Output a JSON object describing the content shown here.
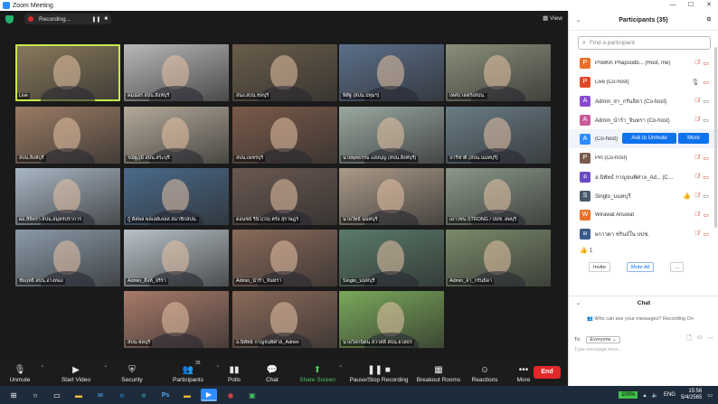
{
  "window": {
    "title": "Zoom Meeting",
    "controls": [
      "—",
      "☐",
      "✕"
    ]
  },
  "video": {
    "recording_label": "Recording...",
    "view_label": "View",
    "tiles": [
      {
        "name": "Live",
        "bg": "#8a7a5c",
        "active": true
      },
      {
        "name": "คมน์สร สปน.สิงห์บุรี",
        "bg": "#b8b8b8"
      },
      {
        "name": "สนง.สปน.ชลบุรี",
        "bg": "#6a5d4a"
      },
      {
        "name": "พิสิฐ (สปน.ปทุมฯ)",
        "bg": "#5b6f8a"
      },
      {
        "name": "เทศบาลตรังสปน.",
        "bg": "#8a8f7a"
      },
      {
        "name": "สปน.สิงห์บุรี",
        "bg": "#9a7b64"
      },
      {
        "name": "รณัฐภูมิ สปน.สระบุรี",
        "bg": "#b4aa9a"
      },
      {
        "name": "สปน.เพชรบุรี",
        "bg": "#7a5a4a"
      },
      {
        "name": "นายพุทธรรม แสงบุญ (สปน.สิงห์บุรี)",
        "bg": "#9aa8a0"
      },
      {
        "name": "ปาริชาติ (สปน.นนทบุรี)",
        "bg": "#6a7c86"
      },
      {
        "name": "ผอ.ลิจิตรา สปน.สมุทรปราการ",
        "bg": "#a8b6c4"
      },
      {
        "name": "กู้ ดิสพล พลเลย์เลลส สมาชิกสปน.",
        "bg": "#4a6a8a"
      },
      {
        "name": "ดอนชธ์ รินิว(ใจ) ตรัง สุราษฎร์",
        "bg": "#6a5850"
      },
      {
        "name": "นายวัทธ์ นนทบุรี",
        "bg": "#aa9a88"
      },
      {
        "name": "เยาวชน STRONG / ปปช. ลพบุรี",
        "bg": "#8a9888"
      },
      {
        "name": "ชัยฤทธิ์ สปน.อ่างทอง",
        "bg": "#8a9aa8"
      },
      {
        "name": "Admin_สิงห์_จรีรา",
        "bg": "#b8c2c8"
      },
      {
        "name": "Admin_นำร้า_จินทรา",
        "bg": "#8a6a5a"
      },
      {
        "name": "Singto_นนทบุรี",
        "bg": "#5a7a6a"
      },
      {
        "name": "Admin_จ่า_กรันธิดา",
        "bg": "#7a8a6a"
      },
      {
        "name": "สปน.ชลบุรี",
        "bg": "#a87a6a"
      },
      {
        "name": "อ.นิพัทธ์ กาญจนพิศาล_Admin",
        "bg": "#8a6a5a"
      },
      {
        "name": "นายวิสกนิตน สวาสดิ์ สปน.ยโสธร",
        "bg": "#7aa85a"
      }
    ]
  },
  "toolbar": {
    "unmute": "Unmute",
    "start_video": "Start Video",
    "security": "Security",
    "participants": "Participants",
    "participant_count": "35",
    "polls": "Polls",
    "chat": "Chat",
    "share_screen": "Share Screen",
    "pause_recording": "Pause/Stop Recording",
    "breakout_rooms": "Breakout Rooms",
    "reactions": "Reactions",
    "more": "More",
    "end": "End"
  },
  "panel": {
    "title": "Participants (35)",
    "search_placeholder": "Find a participant",
    "participants": [
      {
        "avatar": "P",
        "color": "#e8702a",
        "name": "PSBKK Phapsodb... (Host, me)"
      },
      {
        "avatar": "P",
        "color": "#e04a2a",
        "name": "Live (Co-host)"
      },
      {
        "avatar": "A",
        "color": "#8a4ad0",
        "name": "Admin_จ่า_กรันธิดา (Co-host)"
      },
      {
        "avatar": "A",
        "color": "#c85a9a",
        "name": "Admin_นำร้า_จินทรา (Co-host)"
      },
      {
        "avatar": "A",
        "color": "#2d8cff",
        "name": "(Co-host)"
      },
      {
        "avatar": "P",
        "color": "#7a5a4a",
        "name": "Pin (Co-host)"
      },
      {
        "avatar": "อ",
        "color": "#6a4ac0",
        "name": "อ.นิพัทธ์ กาญจนพิศาล_Ad... (Co-host)"
      },
      {
        "avatar": "S",
        "color": "#4a5a6a",
        "name": "Singto_นนทบุรี"
      },
      {
        "avatar": "W",
        "color": "#e8702a",
        "name": "Wirawat Anuwat"
      },
      {
        "avatar": "ผ",
        "color": "#3a5a8a",
        "name": "ผกาวดา ชรินธ์ใน ปปช."
      }
    ],
    "ask_unmute": "Ask to Unmute",
    "more_label": "More",
    "reaction_count": "1",
    "invite": "Invite",
    "mute_all": "Mute All",
    "more_dots": "...",
    "chat_title": "Chat",
    "chat_info": "Who can see your messages? Recording On",
    "to_label": "To:",
    "to_value": "Everyone",
    "message_placeholder": "Type message here..."
  },
  "taskbar": {
    "battery": "100%",
    "lang": "ENG",
    "time": "15:56",
    "date": "5/4/2565"
  }
}
